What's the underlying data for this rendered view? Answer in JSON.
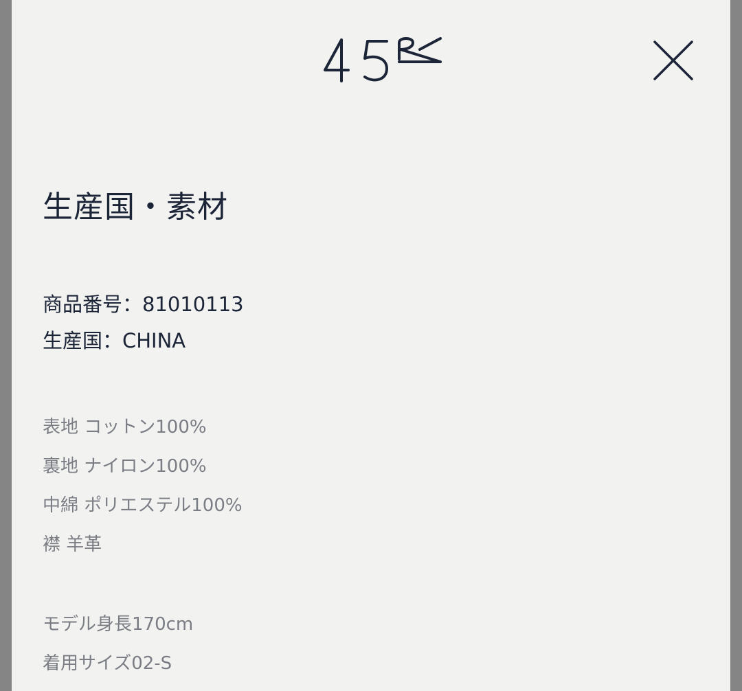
{
  "header": {
    "logo_text": "45R",
    "close_icon": "close-icon"
  },
  "section": {
    "title": "生産国・素材"
  },
  "product": {
    "item_number": "商品番号：81010113",
    "country": "生産国：CHINA"
  },
  "materials": [
    "表地 コットン100%",
    "裏地 ナイロン100%",
    "中綿 ポリエステル100%",
    "襟 羊革"
  ],
  "model": {
    "height": "モデル身長170cm",
    "size": "着用サイズ02-S"
  },
  "colors": {
    "text_primary": "#1c2438",
    "text_secondary": "#7a7d84",
    "panel_background": "#f2f2f0",
    "backdrop": "#858585"
  }
}
